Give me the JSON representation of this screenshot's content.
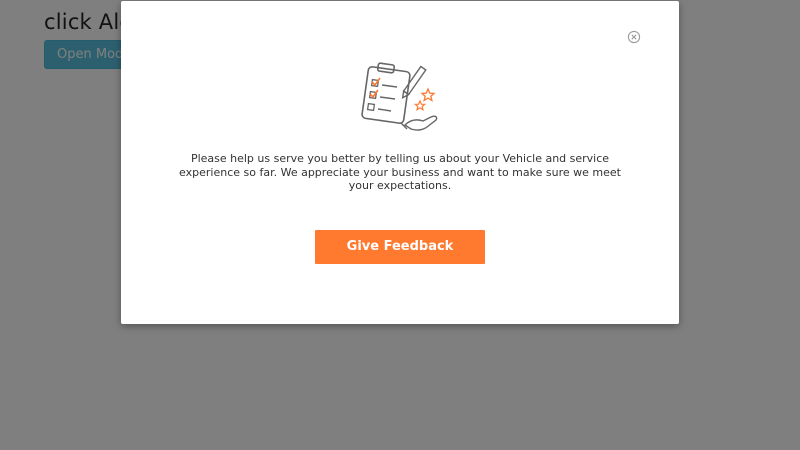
{
  "page": {
    "heading": "click Ale",
    "open_modal_label": "Open Moda"
  },
  "modal": {
    "close_icon": "close-circle-icon",
    "illustration_icon": "feedback-checklist-illustration",
    "message": "Please help us serve you better by telling us about your Vehicle and service experience so far. We appreciate your business and want to make sure we meet your expectations.",
    "cta_label": "Give Feedback"
  },
  "colors": {
    "backdrop": "rgba(0,0,0,0.5)",
    "cta": "#ff7a2f",
    "open_modal_button": "#5bc0de",
    "icon_gray": "#666666",
    "icon_accent": "#ff7a2f"
  }
}
